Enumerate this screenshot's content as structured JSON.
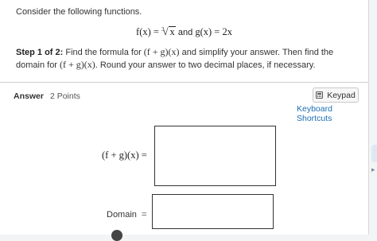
{
  "question": {
    "intro": "Consider the following functions.",
    "formula_f": "f(x) = ",
    "root_index": "3",
    "radicand": "x",
    "and": "and",
    "formula_g": "g(x) = 2x",
    "step_label": "Step 1 of 2:",
    "step_text_a": " Find the formula for ",
    "step_expr": "(f + g)(x)",
    "step_text_b": " and simplify your answer. Then find the domain for ",
    "step_expr_2": "(f + g)(x)",
    "step_text_c": ". Round your answer to two decimal places, if necessary."
  },
  "answer": {
    "label": "Answer",
    "points": "2 Points"
  },
  "keypad_label": "Keypad",
  "shortcuts_label": "Keyboard Shortcuts",
  "inputs": {
    "fg_label": "(f + g)(x) =",
    "fg_value": "",
    "domain_label": "Domain",
    "domain_eq": "=",
    "domain_value": ""
  }
}
